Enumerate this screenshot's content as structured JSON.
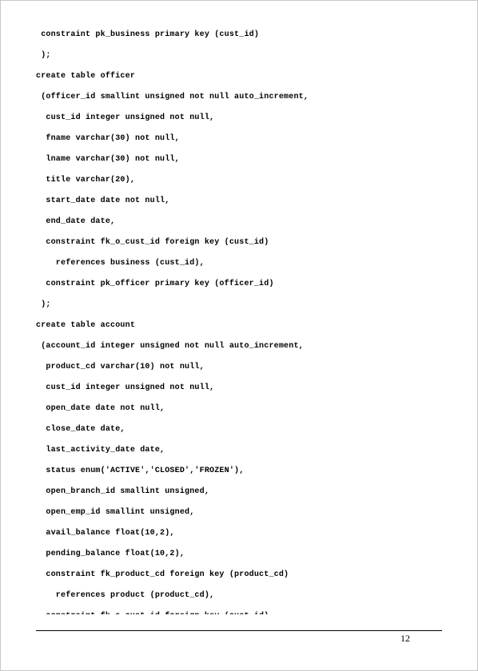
{
  "page_number": "12",
  "code_lines": [
    " constraint pk_business primary key (cust_id)",
    " );",
    "",
    "create table officer",
    " (officer_id smallint unsigned not null auto_increment,",
    "  cust_id integer unsigned not null,",
    "  fname varchar(30) not null,",
    "  lname varchar(30) not null,",
    "  title varchar(20),",
    "  start_date date not null,",
    "  end_date date,",
    "  constraint fk_o_cust_id foreign key (cust_id)",
    "    references business (cust_id),",
    "  constraint pk_officer primary key (officer_id)",
    " );",
    "",
    "create table account",
    " (account_id integer unsigned not null auto_increment,",
    "  product_cd varchar(10) not null,",
    "  cust_id integer unsigned not null,",
    "  open_date date not null,",
    "  close_date date,",
    "  last_activity_date date,",
    "  status enum('ACTIVE','CLOSED','FROZEN'),",
    "  open_branch_id smallint unsigned,",
    "  open_emp_id smallint unsigned,",
    "  avail_balance float(10,2),",
    "  pending_balance float(10,2),",
    "  constraint fk_product_cd foreign key (product_cd)",
    "    references product (product_cd),",
    "  constraint fk_a_cust_id foreign key (cust_id)"
  ]
}
